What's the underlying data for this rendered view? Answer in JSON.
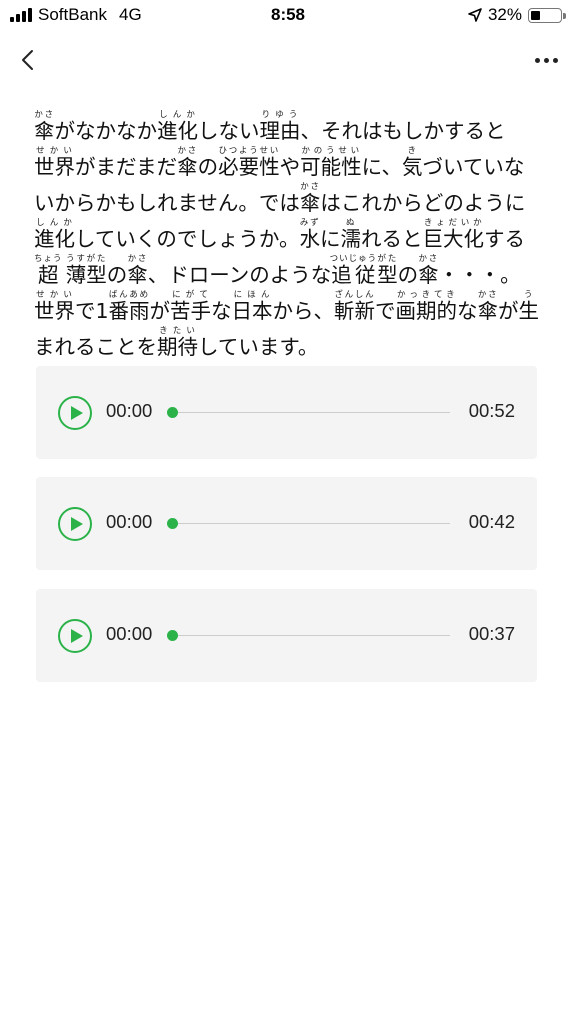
{
  "status_bar": {
    "carrier": "SoftBank",
    "network": "4G",
    "time": "8:58",
    "location_icon": "location-arrow-icon",
    "battery_percent": "32%",
    "battery_level": 0.32
  },
  "nav": {
    "back_icon": "chevron-left-icon",
    "more_icon": "ellipsis-icon"
  },
  "article": {
    "segments": [
      {
        "t": "傘",
        "r": "かさ"
      },
      {
        "t": "がなかなか"
      },
      {
        "t": "進化",
        "r": "しんか"
      },
      {
        "t": "しない"
      },
      {
        "t": "理由",
        "r": "りゆう"
      },
      {
        "t": "、それはもしかすると"
      },
      {
        "t": "世界",
        "r": "せかい"
      },
      {
        "t": "がまだまだ"
      },
      {
        "t": "傘",
        "r": "かさ"
      },
      {
        "t": "の"
      },
      {
        "t": "必要性",
        "r": "ひつようせい"
      },
      {
        "t": "や"
      },
      {
        "t": "可能性",
        "r": "かのうせい"
      },
      {
        "t": "に、"
      },
      {
        "t": "気",
        "r": "き"
      },
      {
        "t": "づいていないからかもしれません。では"
      },
      {
        "t": "傘",
        "r": "かさ"
      },
      {
        "t": "はこれからどのように"
      },
      {
        "t": "進化",
        "r": "しんか"
      },
      {
        "t": "していくのでしょうか。"
      },
      {
        "t": "水",
        "r": "みず"
      },
      {
        "t": "に"
      },
      {
        "t": "濡",
        "r": "ぬ"
      },
      {
        "t": "れると"
      },
      {
        "t": "巨大化",
        "r": "きょだいか"
      },
      {
        "t": "する"
      },
      {
        "t": "超",
        "r": "ちょう"
      },
      {
        "t": " "
      },
      {
        "t": "薄型",
        "r": "うすがた"
      },
      {
        "t": "の"
      },
      {
        "t": "傘",
        "r": "かさ"
      },
      {
        "t": "、ドローンのような"
      },
      {
        "t": "追従",
        "r": "ついじゅう"
      },
      {
        "t": "型",
        "r": "がた"
      },
      {
        "t": "の"
      },
      {
        "t": "傘",
        "r": "かさ"
      },
      {
        "t": "・・・。"
      },
      {
        "t": "世界",
        "r": "せかい"
      },
      {
        "t": "で1"
      },
      {
        "t": "番雨",
        "r": "ばんあめ"
      },
      {
        "t": "が"
      },
      {
        "t": "苦手",
        "r": "にがて"
      },
      {
        "t": "な"
      },
      {
        "t": "日本",
        "r": "にほん"
      },
      {
        "t": "から、"
      },
      {
        "t": "斬新",
        "r": "ざんしん"
      },
      {
        "t": "で"
      },
      {
        "t": "画期的",
        "r": "かっきてき"
      },
      {
        "t": "な"
      },
      {
        "t": "傘",
        "r": "かさ"
      },
      {
        "t": "が"
      },
      {
        "t": "生",
        "r": "う"
      },
      {
        "t": "まれることを"
      },
      {
        "t": "期待",
        "r": "きたい"
      },
      {
        "t": "しています。"
      }
    ]
  },
  "audio_players": [
    {
      "current_time": "00:00",
      "total_time": "00:52",
      "progress": 0,
      "play_icon": "play-icon"
    },
    {
      "current_time": "00:00",
      "total_time": "00:42",
      "progress": 0,
      "play_icon": "play-icon"
    },
    {
      "current_time": "00:00",
      "total_time": "00:37",
      "progress": 0,
      "play_icon": "play-icon"
    }
  ],
  "colors": {
    "accent": "#2bb34a",
    "card_background": "#f4f4f4"
  }
}
